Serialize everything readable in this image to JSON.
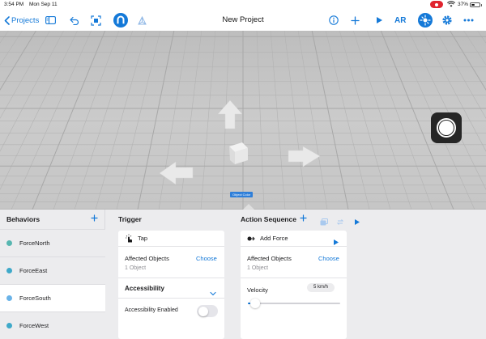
{
  "status_bar": {
    "time": "3:54 PM",
    "date": "Mon Sep 11",
    "battery": "37%"
  },
  "toolbar": {
    "back_label": "Projects",
    "title": "New Project",
    "ar_label": "AR"
  },
  "viewport": {
    "selected_object_label": "Object Color"
  },
  "behaviors": {
    "heading": "Behaviors",
    "items": [
      {
        "label": "ForceNorth",
        "color": "#57b6b0"
      },
      {
        "label": "ForceEast",
        "color": "#3fa9c9"
      },
      {
        "label": "ForceSouth",
        "color": "#6ab3e8"
      },
      {
        "label": "ForceWest",
        "color": "#3fa9c9"
      }
    ],
    "selected_index": 2
  },
  "trigger": {
    "heading": "Trigger",
    "type_label": "Tap",
    "affected_objects_label": "Affected Objects",
    "choose_label": "Choose",
    "object_count": "1 Object",
    "accessibility_label": "Accessibility",
    "accessibility_enabled_label": "Accessibility Enabled",
    "accessibility_enabled": false
  },
  "action_sequence": {
    "heading": "Action Sequence",
    "action_label": "Add Force",
    "affected_objects_label": "Affected Objects",
    "choose_label": "Choose",
    "object_count": "1 Object",
    "velocity_label": "Velocity",
    "velocity_value": "5 km/h",
    "velocity_fraction": 0.08
  },
  "colors": {
    "accent": "#1479d8",
    "panel_bg": "#ececee",
    "viewport_bg": "#c9c9c9"
  }
}
